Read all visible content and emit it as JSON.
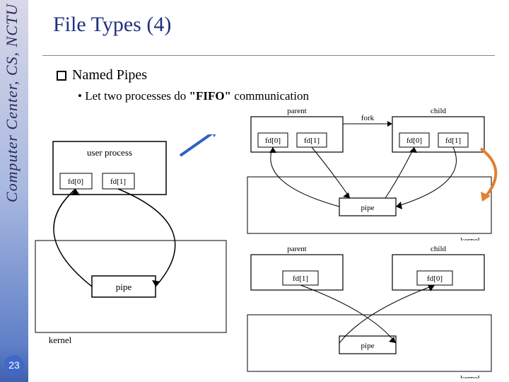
{
  "sidebar": {
    "org_text": "Computer Center, CS, NCTU"
  },
  "slide_number": "23",
  "title": "File Types (4)",
  "bullets": {
    "main": "Named Pipes",
    "sub_prefix": "Let two processes do ",
    "sub_quoted": "\"FIFO\"",
    "sub_suffix": " communication"
  },
  "diagram": {
    "left": {
      "user_process": "user process",
      "fd0": "fd[0]",
      "fd1": "fd[1]",
      "pipe": "pipe",
      "kernel": "kernel"
    },
    "right_top": {
      "parent": "parent",
      "child": "child",
      "fd0": "fd[0]",
      "fd1": "fd[1]",
      "pipe": "pipe",
      "kernel": "kernel"
    },
    "right_bottom": {
      "parent": "parent",
      "child": "child",
      "fd1": "fd[1]",
      "fd0": "fd[0]",
      "pipe": "pipe",
      "kernel": "kernel"
    }
  }
}
